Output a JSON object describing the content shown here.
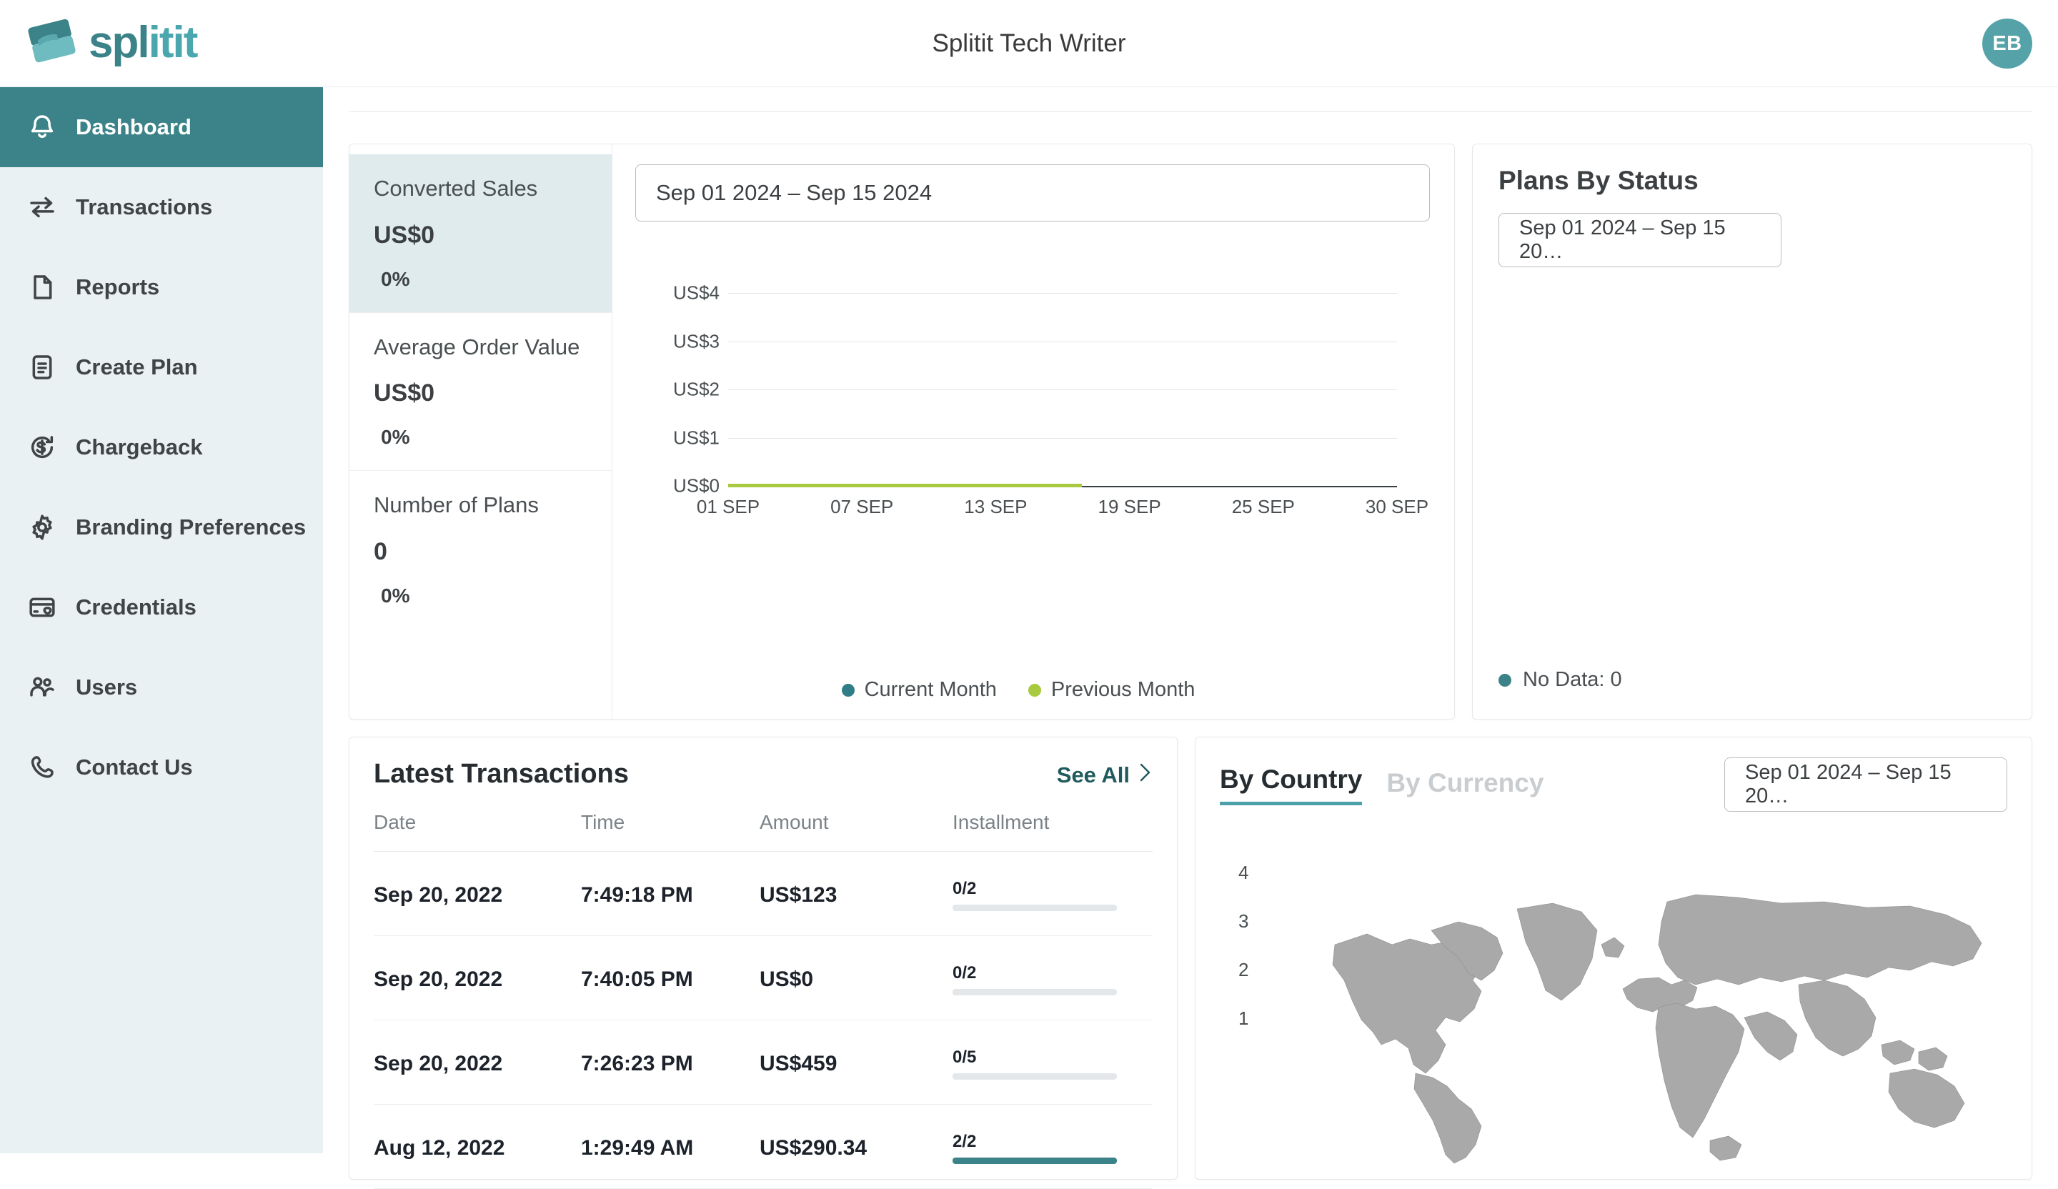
{
  "header": {
    "logo_text_a": "spl",
    "logo_text_b": "itit",
    "title": "Splitit Tech Writer",
    "avatar_initials": "EB"
  },
  "sidebar": {
    "items": [
      {
        "label": "Dashboard",
        "icon": "bell-icon",
        "active": true
      },
      {
        "label": "Transactions",
        "icon": "transfer-icon",
        "active": false
      },
      {
        "label": "Reports",
        "icon": "document-icon",
        "active": false
      },
      {
        "label": "Create Plan",
        "icon": "list-doc-icon",
        "active": false
      },
      {
        "label": "Chargeback",
        "icon": "refund-icon",
        "active": false
      },
      {
        "label": "Branding Preferences",
        "icon": "gear-icon",
        "active": false
      },
      {
        "label": "Credentials",
        "icon": "credit-card-icon",
        "active": false
      },
      {
        "label": "Users",
        "icon": "users-icon",
        "active": false
      },
      {
        "label": "Contact Us",
        "icon": "phone-icon",
        "active": false
      }
    ]
  },
  "sales_panel": {
    "date_range": "Sep 01 2024 – Sep 15 2024",
    "kpis": [
      {
        "label": "Converted Sales",
        "value": "US$0",
        "delta": "0%",
        "highlight": true
      },
      {
        "label": "Average Order Value",
        "value": "US$0",
        "delta": "0%",
        "highlight": false
      },
      {
        "label": "Number of Plans",
        "value": "0",
        "delta": "0%",
        "highlight": false
      }
    ],
    "legend": [
      {
        "label": "Current Month",
        "color": "#2f7d86"
      },
      {
        "label": "Previous Month",
        "color": "#a9c93e"
      }
    ]
  },
  "plans_panel": {
    "title": "Plans By Status",
    "date_range": "Sep 01 2024 – Sep 15 20…",
    "legend_label": "No Data: 0",
    "legend_color": "#3c8389"
  },
  "transactions_panel": {
    "title": "Latest Transactions",
    "see_all_label": "See All",
    "see_all_chevron": "chevron-right-icon",
    "columns": [
      "Date",
      "Time",
      "Amount",
      "Installment"
    ],
    "rows": [
      {
        "date": "Sep 20, 2022",
        "time": "7:49:18 PM",
        "amount": "US$123",
        "installment": "0/2",
        "progress": 0
      },
      {
        "date": "Sep 20, 2022",
        "time": "7:40:05 PM",
        "amount": "US$0",
        "installment": "0/2",
        "progress": 0
      },
      {
        "date": "Sep 20, 2022",
        "time": "7:26:23 PM",
        "amount": "US$459",
        "installment": "0/5",
        "progress": 0
      },
      {
        "date": "Aug 12, 2022",
        "time": "1:29:49 AM",
        "amount": "US$290.34",
        "installment": "2/2",
        "progress": 100
      }
    ]
  },
  "geo_panel": {
    "tabs": [
      {
        "label": "By Country",
        "active": true
      },
      {
        "label": "By Currency",
        "active": false
      }
    ],
    "date_range": "Sep 01 2024 – Sep 15 20…",
    "scale": [
      "4",
      "3",
      "2",
      "1"
    ]
  },
  "colors": {
    "brand_teal": "#3c8389",
    "brand_teal_light": "#4aa7ad",
    "sidebar_bg": "#e9f1f2",
    "kpi_highlight": "#dfebec",
    "series_current": "#2f7d86",
    "series_previous": "#a9c93e",
    "map_land": "#a9a9a9"
  },
  "chart_data": {
    "type": "line",
    "title": "",
    "xlabel": "",
    "ylabel": "",
    "ylim": [
      0,
      4
    ],
    "ytick_labels": [
      "US$0",
      "US$1",
      "US$2",
      "US$3",
      "US$4"
    ],
    "ytick_values": [
      0,
      1,
      2,
      3,
      4
    ],
    "xtick_labels": [
      "01 SEP",
      "07 SEP",
      "13 SEP",
      "19 SEP",
      "25 SEP",
      "30 SEP"
    ],
    "grid": true,
    "legend_position": "bottom-center",
    "x": [
      "01 SEP",
      "02 SEP",
      "03 SEP",
      "04 SEP",
      "05 SEP",
      "06 SEP",
      "07 SEP",
      "08 SEP",
      "09 SEP",
      "10 SEP",
      "11 SEP",
      "12 SEP",
      "13 SEP",
      "14 SEP",
      "15 SEP"
    ],
    "series": [
      {
        "name": "Current Month",
        "color": "#2f7d86",
        "values": [
          0,
          0,
          0,
          0,
          0,
          0,
          0,
          0,
          0,
          0,
          0,
          0,
          0,
          0,
          0
        ]
      },
      {
        "name": "Previous Month",
        "color": "#a9c93e",
        "values": [
          0,
          0,
          0,
          0,
          0,
          0,
          0,
          0,
          0,
          0,
          0,
          0,
          0,
          0,
          0
        ]
      }
    ]
  }
}
